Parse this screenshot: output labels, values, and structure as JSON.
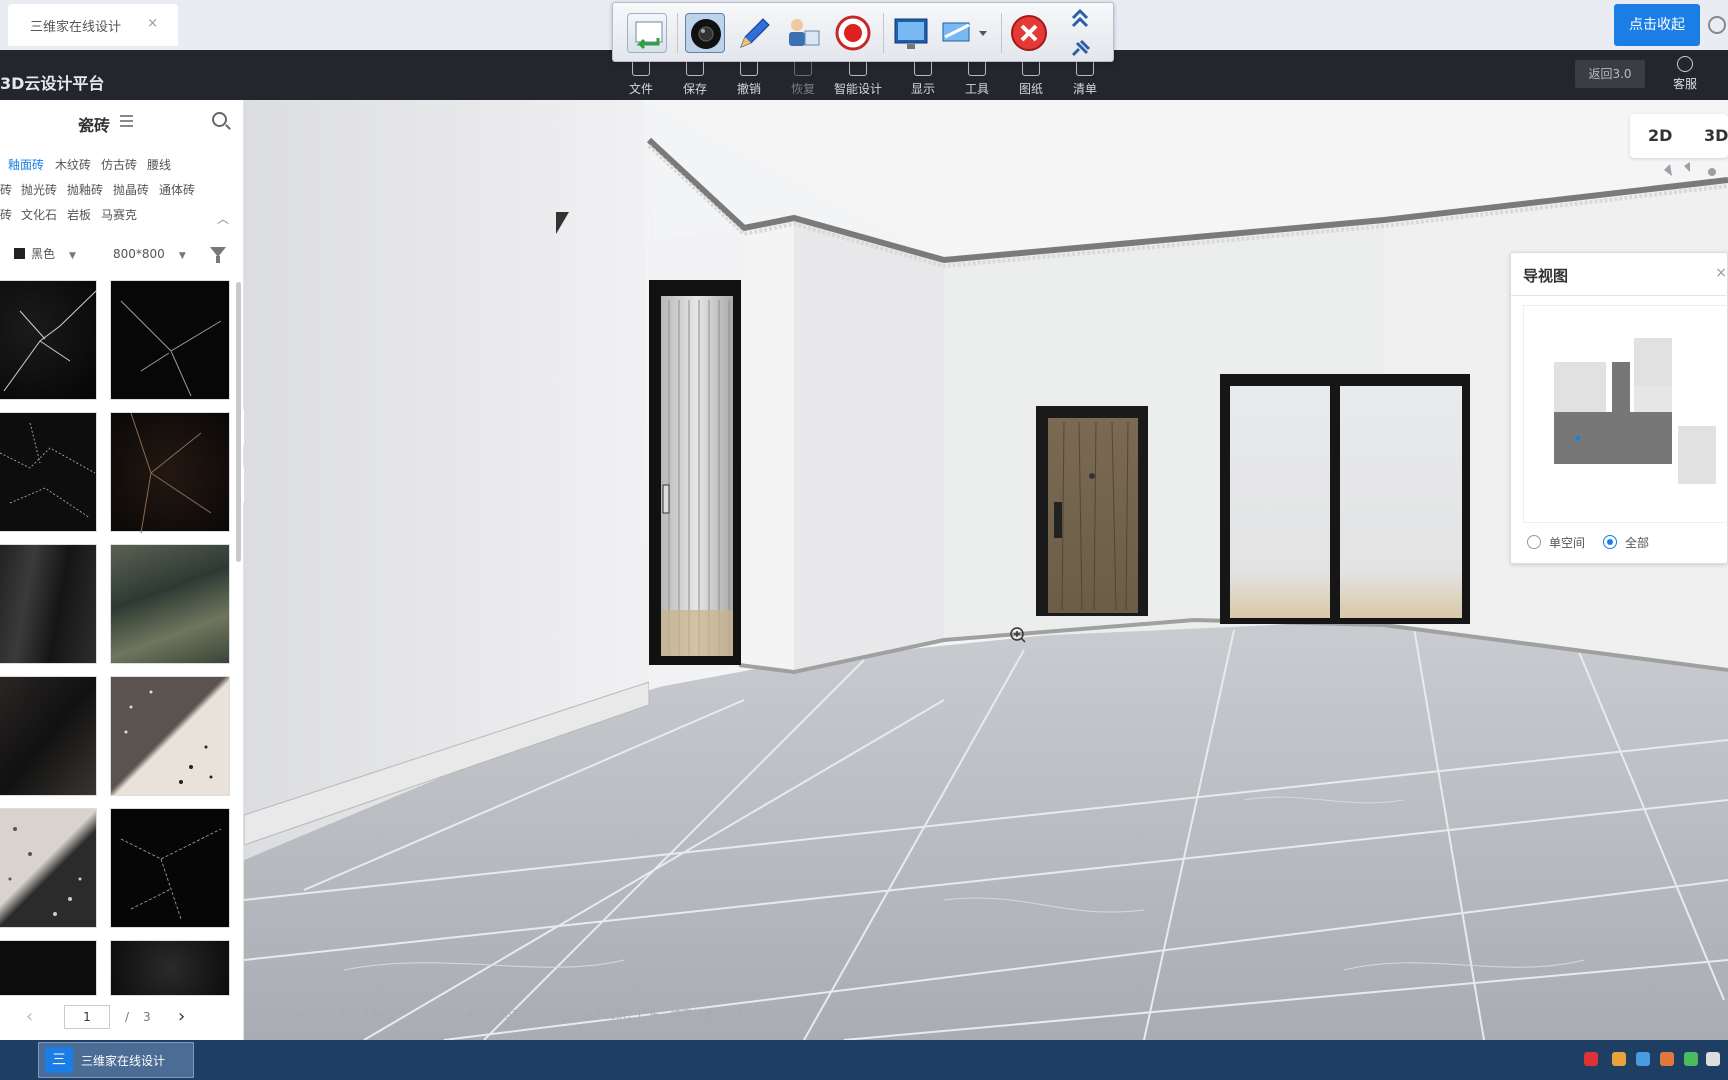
{
  "browser_tab": {
    "title": "三维家在线设计",
    "close": "×"
  },
  "collapse_button": "点击收起",
  "app": {
    "brand": "3D云设计平台"
  },
  "toolbar": [
    {
      "label": "文件",
      "icon": "file-icon"
    },
    {
      "label": "保存",
      "icon": "save-icon"
    },
    {
      "label": "撤销",
      "icon": "undo-icon"
    },
    {
      "label": "恢复",
      "icon": "redo-icon",
      "disabled": true
    },
    {
      "label": "智能设计",
      "icon": "smart-design-icon"
    },
    {
      "label": "显示",
      "icon": "eye-icon"
    },
    {
      "label": "工具",
      "icon": "wrench-icon"
    },
    {
      "label": "图纸",
      "icon": "drawing-icon"
    },
    {
      "label": "清单",
      "icon": "checklist-icon"
    }
  ],
  "back_button": "返回3.0",
  "service": "客服",
  "recorder_icons": [
    "return-icon",
    "camera-icon",
    "pen-icon",
    "presenter-icon",
    "record-icon",
    "screen-icon",
    "monitor-dropdown-icon",
    "close-circle-icon",
    "double-chevron-up-icon",
    "pin-icon"
  ],
  "panel": {
    "title": "瓷砖",
    "categories": [
      [
        {
          "label": "釉面砖",
          "active": true
        },
        {
          "label": "木纹砖"
        },
        {
          "label": "仿古砖"
        },
        {
          "label": "腰线"
        }
      ],
      [
        {
          "label": "砖"
        },
        {
          "label": "抛光砖"
        },
        {
          "label": "抛釉砖"
        },
        {
          "label": "抛晶砖"
        },
        {
          "label": "通体砖"
        }
      ],
      [
        {
          "label": "砖"
        },
        {
          "label": "文化石"
        },
        {
          "label": "岩板"
        },
        {
          "label": "马赛克"
        }
      ]
    ],
    "filters": {
      "color": "黑色",
      "size": "800*800"
    },
    "pagination": {
      "current": "1",
      "separator": "/",
      "total": "3"
    }
  },
  "view_toggle": {
    "two_d": "2D",
    "three_d": "3D"
  },
  "navmap": {
    "title": "导视图",
    "close": "×",
    "options": [
      "单空间",
      "全部"
    ],
    "selected": "全部"
  },
  "status": {
    "area": "实用面积：100.17m²",
    "version": "V:4.0.0.957",
    "provider": "技术提供：广东三维家信息科技有限公司"
  },
  "taskbar": {
    "app_label": "三维家在线设计",
    "icon_glyph": "三"
  },
  "colors": {
    "accent": "#1a7ee6",
    "header_bg": "#23262c",
    "taskbar_bg": "#1e3e64"
  }
}
